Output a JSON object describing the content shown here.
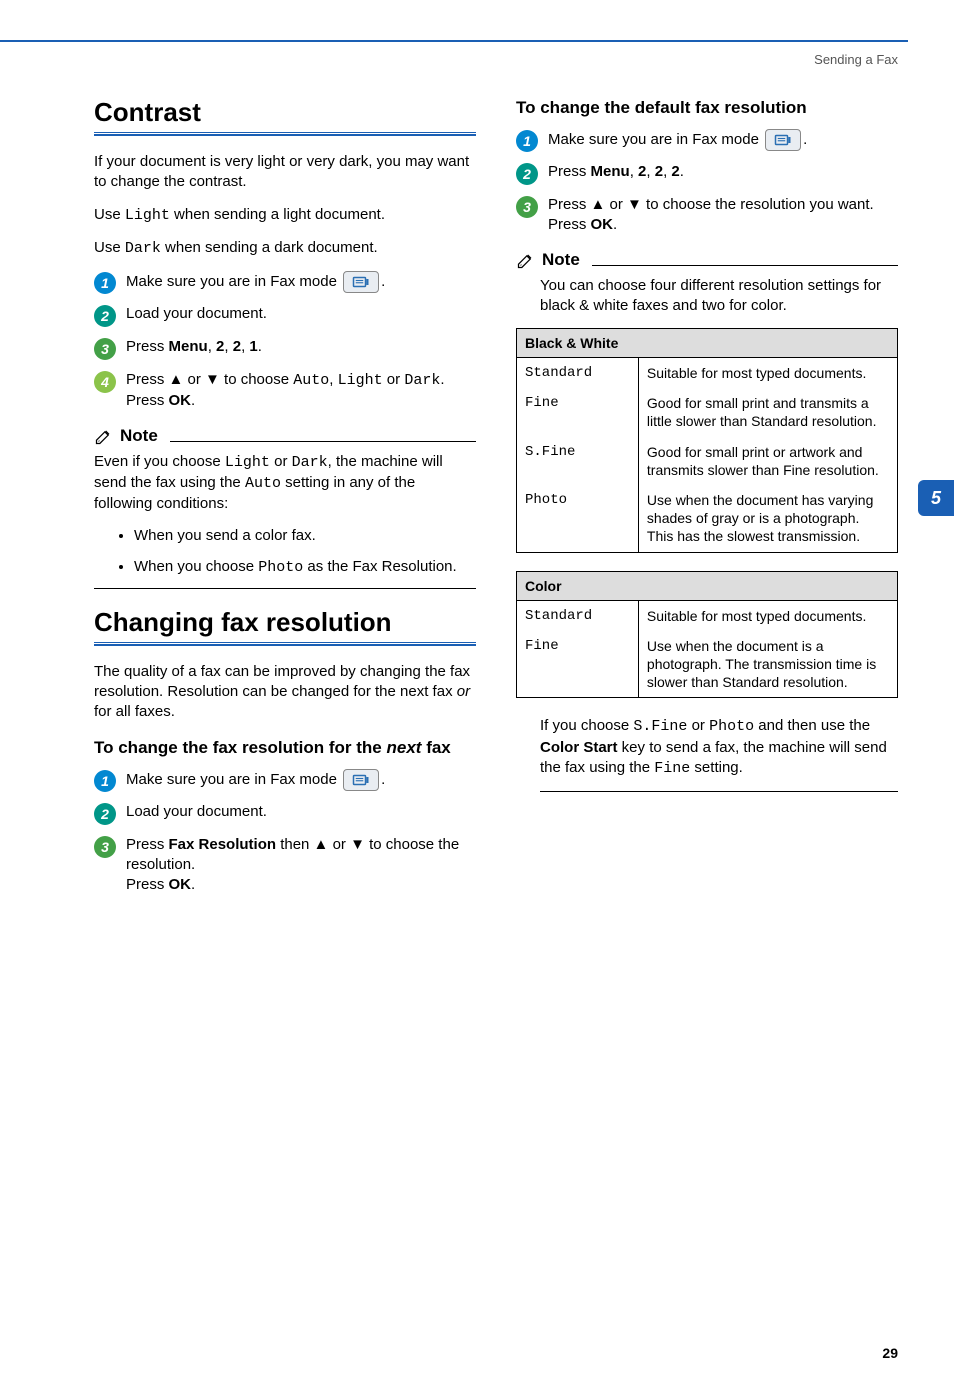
{
  "header": {
    "breadcrumb": "Sending a Fax"
  },
  "tab": {
    "label": "5"
  },
  "left": {
    "contrast": {
      "title": "Contrast",
      "intro": "If your document is very light or very dark, you may want to change the contrast.",
      "use_light_pre": "Use ",
      "use_light_mono": "Light",
      "use_light_post": " when sending a light document.",
      "use_dark_pre": "Use ",
      "use_dark_mono": "Dark",
      "use_dark_post": " when sending a dark document.",
      "steps": {
        "s1": "Make sure you are in Fax mode ",
        "s1_tail": ".",
        "s2": "Load your document.",
        "s3_pre": "Press ",
        "s3_b1": "Menu",
        "s3_mid1": ", ",
        "s3_b2": "2",
        "s3_mid2": ", ",
        "s3_b3": "2",
        "s3_mid3": ", ",
        "s3_b4": "1",
        "s3_post": ".",
        "s4_pre": "Press ▲ or ▼ to choose ",
        "s4_m1": "Auto",
        "s4_mid1": ", ",
        "s4_m2": "Light",
        "s4_mid2": " or ",
        "s4_m3": "Dark",
        "s4_post1": ".",
        "s4_press": "Press ",
        "s4_ok": "OK",
        "s4_post2": "."
      },
      "note": {
        "label": "Note",
        "body_pre": "Even if you choose ",
        "body_m1": "Light",
        "body_mid1": " or ",
        "body_m2": "Dark",
        "body_mid2": ", the machine will send the fax using the ",
        "body_m3": "Auto",
        "body_post": " setting in any of the following conditions:",
        "bullets": {
          "b1": "When you send a color fax.",
          "b2_pre": "When you choose ",
          "b2_mono": "Photo",
          "b2_post": " as the Fax Resolution."
        }
      }
    },
    "changing": {
      "title": "Changing fax resolution",
      "intro_pre": "The quality of a fax can be improved by changing the fax resolution. Resolution can be changed for the next fax ",
      "intro_em": "or",
      "intro_post": " for all faxes.",
      "sub_pre": "To change the fax resolution for the ",
      "sub_em": "next",
      "sub_post": " fax",
      "steps": {
        "s1": "Make sure you are in Fax mode ",
        "s1_tail": ".",
        "s2": "Load your document.",
        "s3_pre": "Press ",
        "s3_b": "Fax Resolution",
        "s3_mid": " then ▲ or ▼ to choose the resolution.",
        "s3_press": "Press ",
        "s3_ok": "OK",
        "s3_post": "."
      }
    }
  },
  "right": {
    "sub": "To change the default fax resolution",
    "steps": {
      "s1": "Make sure you are in Fax mode ",
      "s1_tail": ".",
      "s2_pre": "Press ",
      "s2_b1": "Menu",
      "s2_mid1": ", ",
      "s2_b2": "2",
      "s2_mid2": ", ",
      "s2_b3": "2",
      "s2_mid3": ", ",
      "s2_b4": "2",
      "s2_post": ".",
      "s3_line1": "Press ▲ or ▼ to choose the resolution you want.",
      "s3_press": "Press ",
      "s3_ok": "OK",
      "s3_post": "."
    },
    "note": {
      "label": "Note",
      "body": "You can choose four different resolution settings for black & white faxes and two for color."
    },
    "tables": {
      "bw": {
        "header": "Black & White",
        "rows": [
          {
            "k": "Standard",
            "v": "Suitable for most typed documents."
          },
          {
            "k": "Fine",
            "v": "Good for small print and transmits a little slower than Standard resolution."
          },
          {
            "k": "S.Fine",
            "v": "Good for small print or artwork and transmits slower than Fine resolution."
          },
          {
            "k": "Photo",
            "v": "Use when the document has varying shades of gray or is a photograph. This has the slowest transmission."
          }
        ]
      },
      "color": {
        "header": "Color",
        "rows": [
          {
            "k": "Standard",
            "v": "Suitable for most typed documents."
          },
          {
            "k": "Fine",
            "v": "Use when the document is a photograph. The transmission time is slower than Standard resolution."
          }
        ]
      }
    },
    "foot": {
      "pre": "If you choose ",
      "m1": "S.Fine",
      "mid1": " or ",
      "m2": "Photo",
      "mid2": " and then use the ",
      "b1": "Color Start",
      "mid3": " key to send a fax, the machine will send the fax using the ",
      "m3": "Fine",
      "post": " setting."
    }
  },
  "page": "29"
}
